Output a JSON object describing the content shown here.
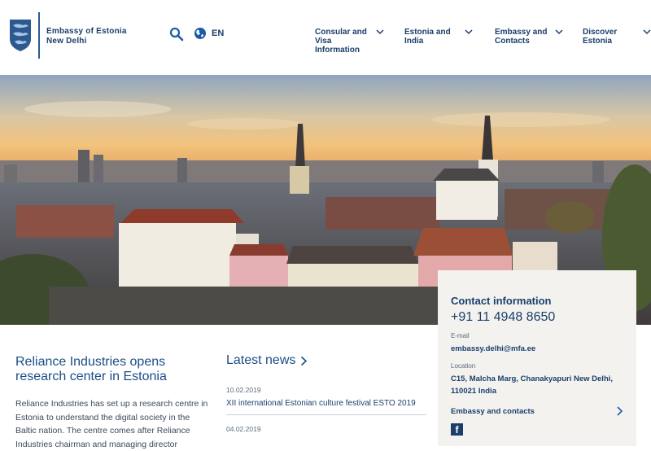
{
  "header": {
    "brand_line1": "Embassy of Estonia",
    "brand_line2": "New Delhi",
    "language": "EN",
    "nav": [
      {
        "label": "Consular and Visa Information"
      },
      {
        "label": "Estonia and India"
      },
      {
        "label": "Embassy and Contacts"
      },
      {
        "label": "Discover Estonia"
      }
    ]
  },
  "icons": {
    "logo": "coat-of-arms-icon",
    "search": "search-icon",
    "globe": "globe-icon",
    "chevron": "chevron-down-icon",
    "arrow": "chevron-right-icon",
    "facebook": "facebook-icon"
  },
  "contact": {
    "title": "Contact information",
    "phone": "+91 11 4948 8650",
    "email_label": "E-mail",
    "email": "embassy.delhi@mfa.ee",
    "location_label": "Location",
    "location": "C15, Malcha Marg, Chanakyapuri New Delhi, 110021 India",
    "embassy_link": "Embassy and contacts",
    "facebook_glyph": "f"
  },
  "article": {
    "title": "Reliance Industries opens research center in Estonia",
    "body": "Reliance Industries has set up a research centre in Estonia to understand the digital society in the Baltic nation. The centre comes after Reliance Industries chairman and managing director"
  },
  "news": {
    "title": "Latest news",
    "items": [
      {
        "date": "10.02.2019",
        "headline": "XII international Estonian culture festival ESTO 2019"
      },
      {
        "date": "04.02.2019",
        "headline": ""
      }
    ]
  },
  "colors": {
    "brand": "#1b3f6b",
    "card_bg": "#f3f2ef"
  }
}
